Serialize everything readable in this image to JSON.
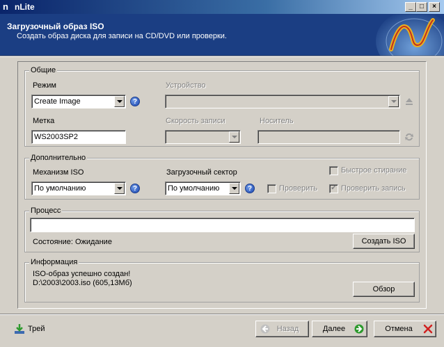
{
  "window": {
    "title": "nLite",
    "app_icon": "n",
    "controls": {
      "minimize": "_",
      "maximize": "□",
      "close": "×"
    }
  },
  "header": {
    "title": "Загрузочный образ ISO",
    "subtitle": "Создать образ диска для записи на CD/DVD или проверки."
  },
  "general": {
    "legend": "Общие",
    "mode_label": "Режим",
    "mode_value": "Create Image",
    "device_label": "Устройство",
    "device_value": "",
    "label_label": "Метка",
    "label_value": "WS2003SP2",
    "speed_label": "Скорость записи",
    "speed_value": "",
    "media_label": "Носитель",
    "media_value": ""
  },
  "advanced": {
    "legend": "Дополнительно",
    "iso_engine_label": "Механизм ISO",
    "iso_engine_value": "По умолчанию",
    "boot_sector_label": "Загрузочный сектор",
    "boot_sector_value": "По умолчанию",
    "quick_erase_label": "Быстрое стирание",
    "quick_erase_checked": false,
    "verify_label": "Проверить",
    "verify_checked": false,
    "verify_write_label": "Проверить запись",
    "verify_write_checked": true
  },
  "process": {
    "legend": "Процесс",
    "progress": 0,
    "status": "Состояние: Ожидание",
    "make_iso_button": "Создать ISO"
  },
  "info": {
    "legend": "Информация",
    "line1": "ISO-образ успешно создан!",
    "line2": "D:\\2003\\2003.iso (605,13Мб)",
    "browse_button": "Обзор"
  },
  "footer": {
    "tray_label": "Трей",
    "back_label": "Назад",
    "next_label": "Далее",
    "cancel_label": "Отмена"
  },
  "colors": {
    "header_bg": "#1b3e83",
    "title_gradient_start": "#0a246a",
    "window_bg": "#d4d0c8",
    "next_icon": "#2e9a2e",
    "cancel_icon": "#d02020"
  },
  "icons": {
    "help": "?",
    "check": "✔"
  }
}
